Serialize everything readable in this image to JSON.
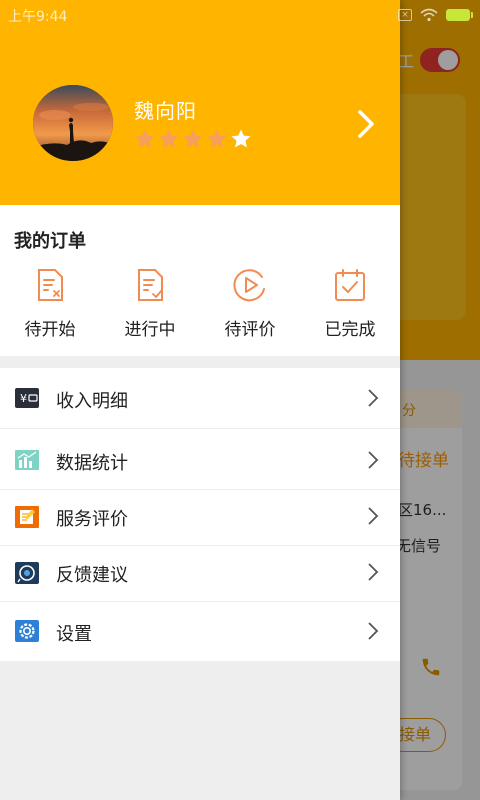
{
  "status_bar": {
    "time": "上午9:44",
    "icons": [
      "notification-x-icon",
      "wifi-icon",
      "battery-charging-icon"
    ]
  },
  "background_app": {
    "toggle_label": "工",
    "card_header": "分",
    "status": "待接单",
    "address": "区16...",
    "signal": "无信号",
    "button": "接单"
  },
  "profile": {
    "name": "魏向阳",
    "rating": 4,
    "rating_max": 5
  },
  "orders": {
    "title": "我的订单",
    "items": [
      {
        "label": "待开始",
        "icon": "doc-x-icon"
      },
      {
        "label": "进行中",
        "icon": "doc-edit-icon"
      },
      {
        "label": "待评价",
        "icon": "play-circle-icon"
      },
      {
        "label": "已完成",
        "icon": "check-box-icon"
      }
    ]
  },
  "menu": {
    "items": [
      {
        "label": "收入明细",
        "icon": "wallet-icon"
      },
      {
        "label": "数据统计",
        "icon": "stats-chart-icon"
      },
      {
        "label": "服务评价",
        "icon": "review-note-icon"
      },
      {
        "label": "反馈建议",
        "icon": "feedback-icon"
      },
      {
        "label": "设置",
        "icon": "settings-gear-icon"
      }
    ]
  },
  "colors": {
    "accent": "#ffb400",
    "order_icon": "#f28b52",
    "star_on": "#f4a05c",
    "star_off": "#ffffff"
  }
}
